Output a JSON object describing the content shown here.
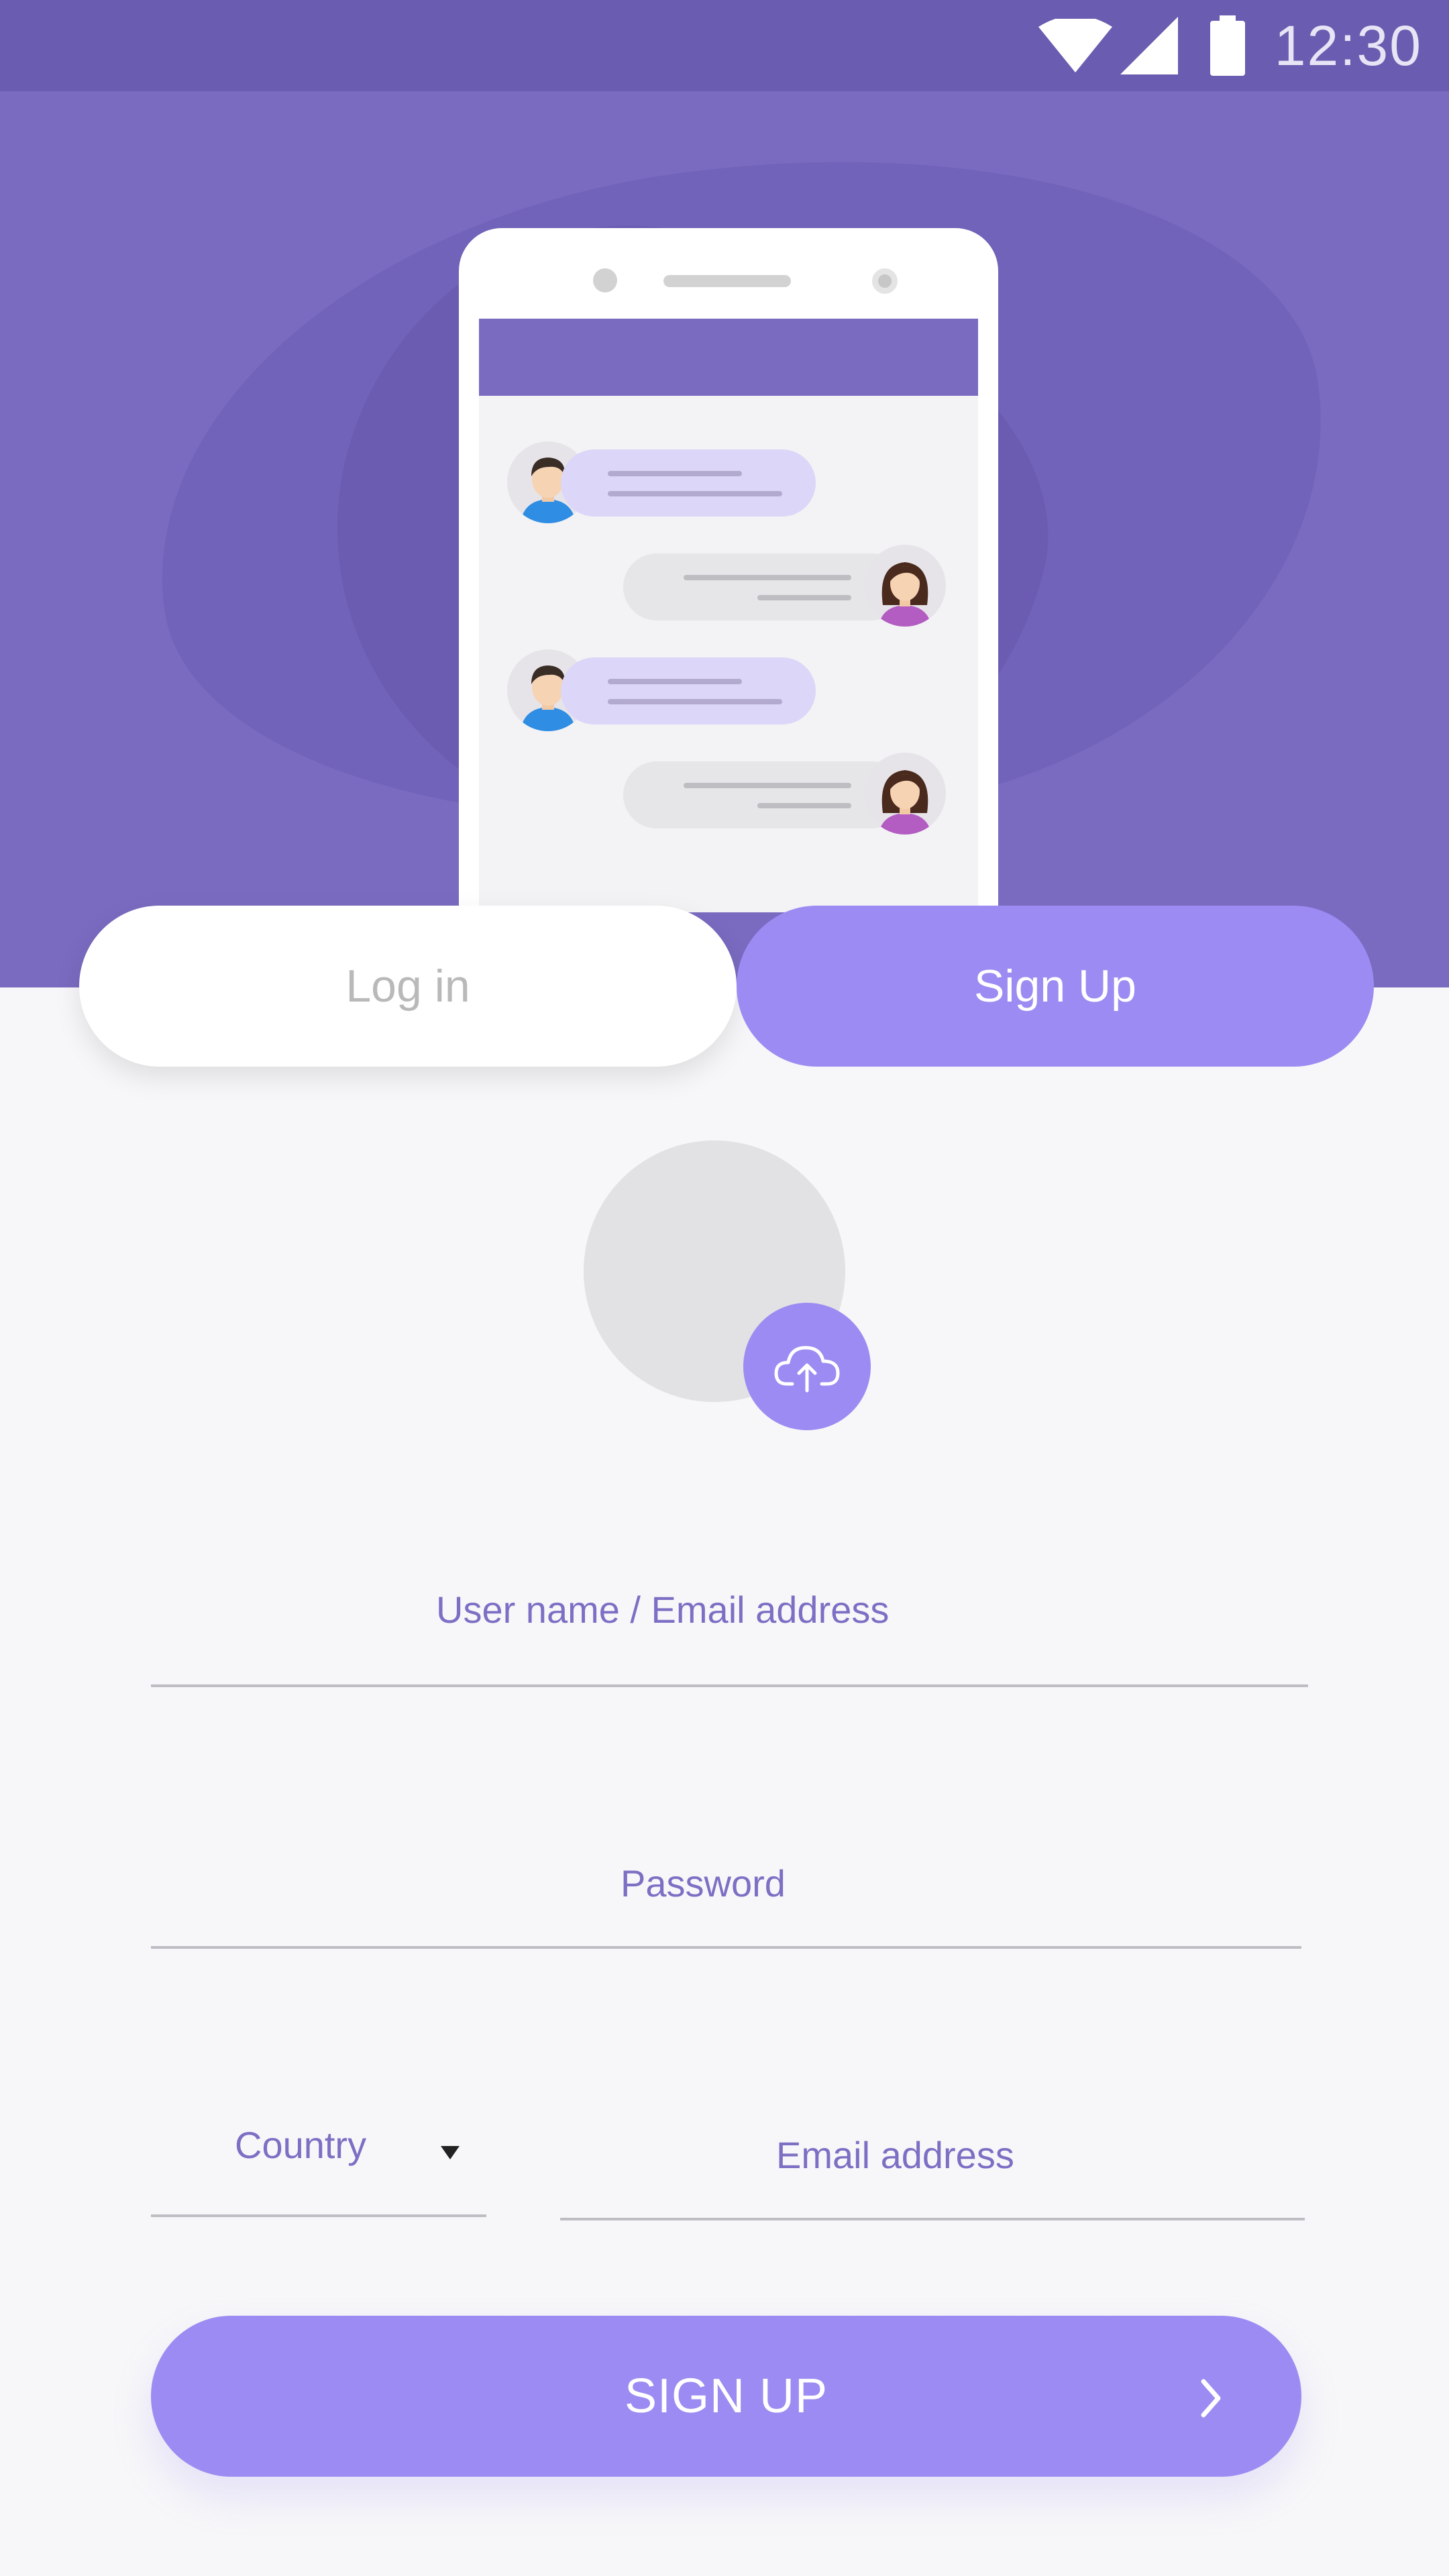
{
  "status_bar": {
    "time": "12:30",
    "icons": [
      "wifi-icon",
      "cellular-signal-icon",
      "battery-icon"
    ]
  },
  "hero": {
    "illustration": "phone-chat-illustration"
  },
  "tabs": {
    "login_label": "Log in",
    "signup_label": "Sign Up",
    "active": "signup"
  },
  "profile": {
    "upload_icon": "cloud-upload-icon"
  },
  "form": {
    "username_placeholder": "User name / Email address",
    "password_placeholder": "Password",
    "country_placeholder": "Country",
    "email_placeholder": "Email address",
    "submit_label": "SIGN UP"
  },
  "colors": {
    "header_bg": "#7a6bc1",
    "accent": "#9c8bf2",
    "placeholder": "#7c6fc4",
    "page_bg": "#f7f7f9"
  }
}
